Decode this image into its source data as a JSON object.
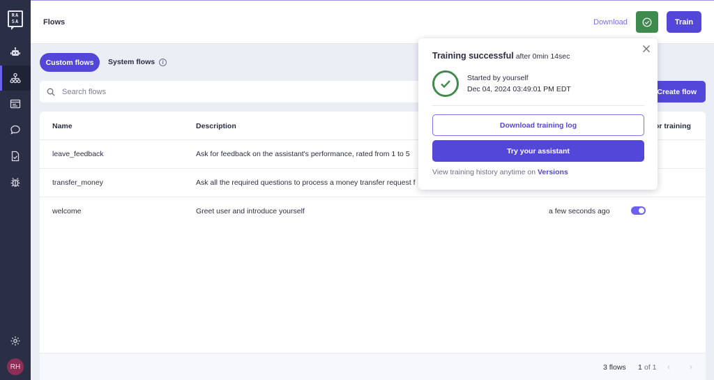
{
  "sidebar": {
    "logo": {
      "line1": "RA",
      "line2": "SA"
    },
    "items": [
      {
        "name": "assistant",
        "icon": "robot-icon",
        "active": false
      },
      {
        "name": "flows",
        "icon": "flow-hierarchy-icon",
        "active": true
      },
      {
        "name": "responses",
        "icon": "browser-window-icon",
        "active": false
      },
      {
        "name": "conversations",
        "icon": "chat-bubble-icon",
        "active": false
      },
      {
        "name": "validation",
        "icon": "document-check-icon",
        "active": false
      },
      {
        "name": "debug",
        "icon": "bug-icon",
        "active": false
      }
    ],
    "settings_icon": "gear-icon",
    "avatar_initials": "RH"
  },
  "header": {
    "title": "Flows",
    "download_label": "Download",
    "status_icon": "check-circle-icon",
    "train_label": "Train"
  },
  "tabs": [
    {
      "label": "Custom flows",
      "selected": true
    },
    {
      "label": "System flows",
      "selected": false,
      "info_icon": "i"
    }
  ],
  "search": {
    "placeholder": "Search flows",
    "value": ""
  },
  "create_flow_label": "Create flow",
  "table": {
    "columns": [
      "Name",
      "Description",
      "or training"
    ],
    "rows": [
      {
        "name": "leave_feedback",
        "description": "Ask for feedback on the assistant's performance, rated from 1 to 5",
        "modified": "",
        "enabled": null
      },
      {
        "name": "transfer_money",
        "description": "Ask all the required questions to process a money transfer request f",
        "modified": "",
        "enabled": null
      },
      {
        "name": "welcome",
        "description": "Greet user and introduce yourself",
        "modified": "a few seconds ago",
        "enabled": true
      }
    ]
  },
  "pagination": {
    "count": "3 flows",
    "page": "1",
    "of": "of 1",
    "prev": "‹",
    "next": "›"
  },
  "popup": {
    "title": "Training successful",
    "duration": "after 0min 14sec",
    "started_by": "Started by yourself",
    "started_at": "Dec 04, 2024 03:49:01 PM EDT",
    "download_log_label": "Download training log",
    "try_label": "Try your assistant",
    "history_text": "View training history anytime on",
    "history_link": "Versions"
  },
  "colors": {
    "sidebar": "#2a2f45",
    "accent": "#5347d9",
    "success": "#3f8b4d",
    "background": "#eceef6"
  }
}
